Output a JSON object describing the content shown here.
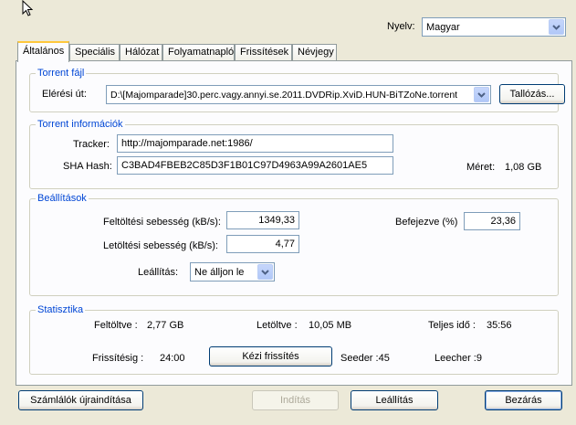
{
  "language": {
    "label": "Nyelv:",
    "selected": "Magyar"
  },
  "tabs": [
    {
      "label": "Általános"
    },
    {
      "label": "Speciális"
    },
    {
      "label": "Hálózat"
    },
    {
      "label": "Folyamatnapló"
    },
    {
      "label": "Frissítések"
    },
    {
      "label": "Névjegy"
    }
  ],
  "torrent_file": {
    "title": "Torrent fájl",
    "path_label": "Elérési út:",
    "path_value": "D:\\[Majomparade]30.perc.vagy.annyi.se.2011.DVDRip.XviD.HUN-BiTZoNe.torrent",
    "browse_button": "Tallózás..."
  },
  "torrent_info": {
    "title": "Torrent információk",
    "tracker_label": "Tracker:",
    "tracker_value": "http://majomparade.net:1986/",
    "sha_label": "SHA Hash:",
    "sha_value": "C3BAD4FBEB2C85D3F1B01C97D4963A99A2601AE5",
    "size_label": "Méret:",
    "size_value": "1,08 GB"
  },
  "settings": {
    "title": "Beállítások",
    "upload_label": "Feltöltési sebesség (kB/s):",
    "upload_value": "1349,33",
    "download_label": "Letöltési sebesség (kB/s):",
    "download_value": "4,77",
    "stop_label": "Leállítás:",
    "stop_value": "Ne álljon le",
    "completed_label": "Befejezve (%)",
    "completed_value": "23,36"
  },
  "stats": {
    "title": "Statisztika",
    "uploaded_label": "Feltöltve :",
    "uploaded_value": "2,77 GB",
    "downloaded_label": "Letöltve :",
    "downloaded_value": "10,05 MB",
    "total_time_label": "Teljes idő :",
    "total_time_value": "35:56",
    "refresh_label": "Frissítésig :",
    "refresh_value": "24:00",
    "manual_refresh_button": "Kézi frissítés",
    "seeder_label": "Seeder :",
    "seeder_value": "45",
    "leecher_label": "Leecher :",
    "leecher_value": "9"
  },
  "footer": {
    "reset_button": "Számlálók újraindítása",
    "start_button": "Indítás",
    "stop_button": "Leállítás",
    "close_button": "Bezárás"
  },
  "colors": {
    "accent": "#0046d5",
    "tab_highlight": "#ffc83c",
    "border": "#7f9db9"
  },
  "icons": {
    "cursor": "mouse-pointer-icon",
    "dropdown": "chevron-down-icon"
  }
}
